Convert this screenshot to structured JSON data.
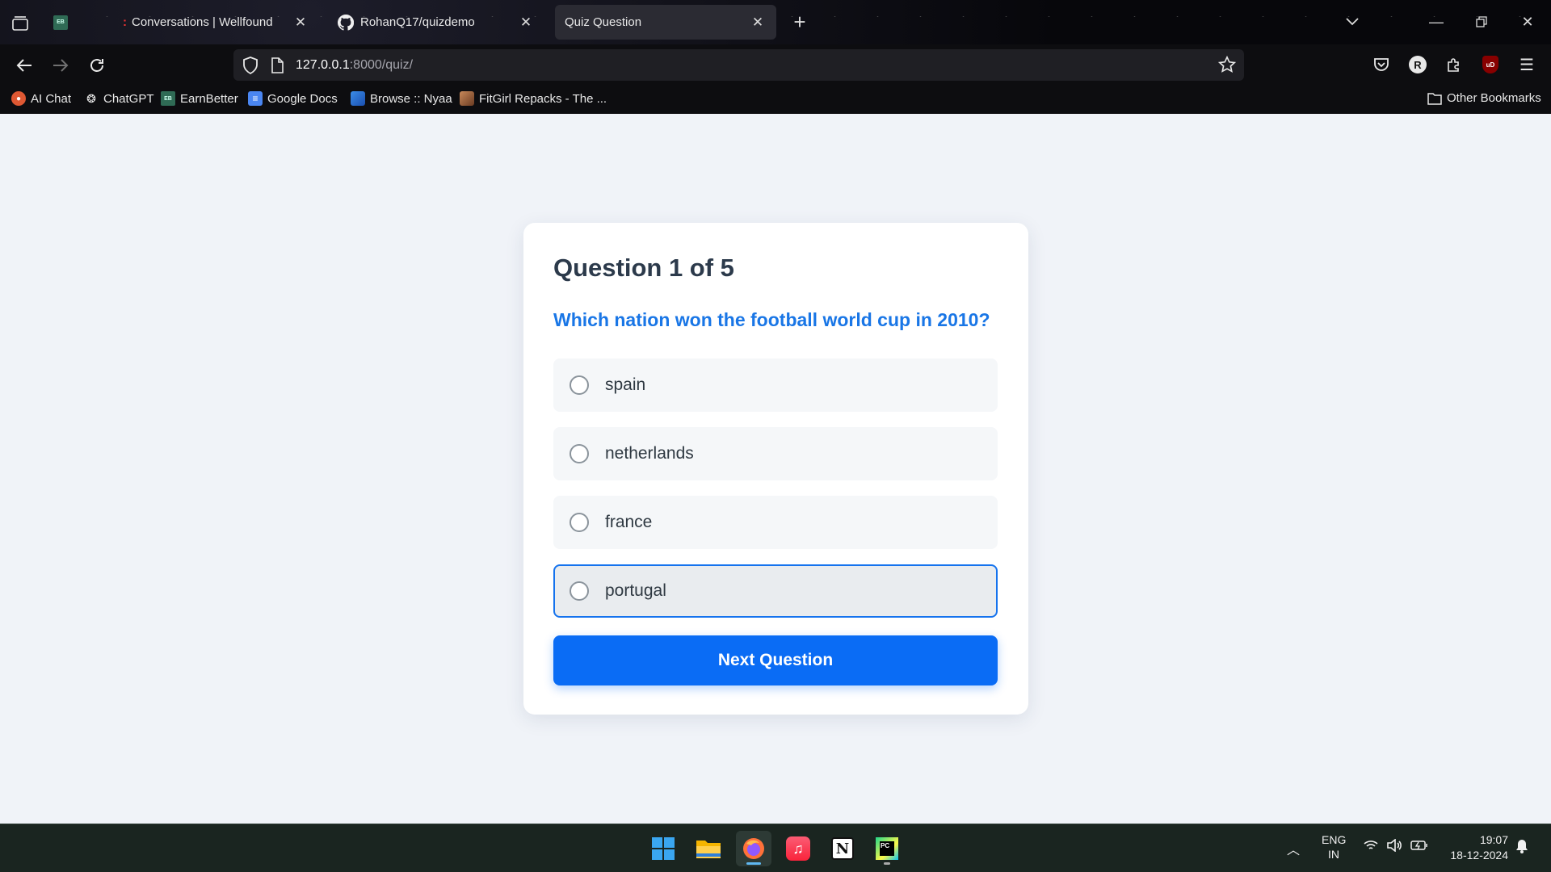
{
  "browser": {
    "tabs": [
      {
        "label": "",
        "favicon": "earnbetter-favicon"
      },
      {
        "label": "Conversations | Wellfound",
        "favicon": "wellfound-favicon"
      },
      {
        "label": "RohanQ17/quizdemo",
        "favicon": "github-icon"
      },
      {
        "label": "Quiz Question",
        "favicon": "none",
        "active": true
      }
    ],
    "url_host": "127.0.0.1",
    "url_rest": ":8000/quiz/",
    "bookmarks": [
      {
        "label": "AI Chat",
        "icon": "duckduckgo-icon"
      },
      {
        "label": "ChatGPT",
        "icon": "chatgpt-icon"
      },
      {
        "label": "EarnBetter",
        "icon": "earnbetter-favicon"
      },
      {
        "label": "Google Docs",
        "icon": "google-docs-icon"
      },
      {
        "label": "Browse :: Nyaa",
        "icon": "nyaa-icon"
      },
      {
        "label": "FitGirl Repacks - The ...",
        "icon": "fitgirl-icon"
      }
    ],
    "other_bookmarks": "Other Bookmarks",
    "profile_initial": "R",
    "extension_badge": "uD"
  },
  "quiz": {
    "progress": "Question 1 of 5",
    "question": "Which nation won the football world cup in 2010?",
    "options": [
      "spain",
      "netherlands",
      "france",
      "portugal"
    ],
    "selected_option": "portugal",
    "next_button": "Next Question"
  },
  "taskbar": {
    "lang_line1": "ENG",
    "lang_line2": "IN",
    "time": "19:07",
    "date": "18-12-2024"
  },
  "colors": {
    "accent": "#0a6cf5",
    "question_text": "#1976e6",
    "page_bg": "#f0f3f8"
  }
}
